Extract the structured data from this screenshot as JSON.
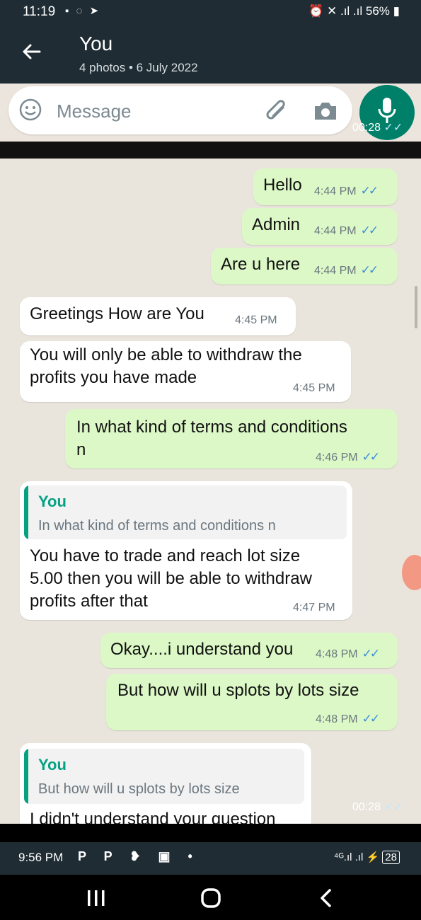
{
  "status_bar": {
    "time": "11:19",
    "battery": "56%"
  },
  "header": {
    "back": "←",
    "contact_name": "You",
    "subtitle": "4 photos • 6 July 2022"
  },
  "compose": {
    "placeholder": "Message"
  },
  "video_overlay": {
    "elapsed": "00:28",
    "ticks": "✓✓"
  },
  "messages": [
    {
      "direction": "out",
      "text": "Hello",
      "time": "4:44 PM",
      "ticks": "✓✓"
    },
    {
      "direction": "out",
      "text": "Admin",
      "time": "4:44 PM",
      "ticks": "✓✓"
    },
    {
      "direction": "out",
      "text": "Are u here",
      "time": "4:44 PM",
      "ticks": "✓✓"
    },
    {
      "direction": "in",
      "text": "Greetings How are You",
      "time": "4:45 PM"
    },
    {
      "direction": "in",
      "line1": "You will only be able to withdraw the",
      "line2": "profits you have made",
      "time": "4:45 PM"
    },
    {
      "direction": "out",
      "line1": "In what kind of terms and  conditions",
      "line2": "n",
      "time": "4:46 PM",
      "ticks": "✓✓"
    },
    {
      "direction": "in",
      "quote_name": "You",
      "quote_text": "In what kind of terms and  conditions n",
      "line1": "You have to trade and reach lot size",
      "line2": "5.00 then you will be able to withdraw",
      "line3": "profits after that",
      "time": "4:47 PM"
    },
    {
      "direction": "out",
      "text": "Okay....i understand you",
      "time": "4:48 PM",
      "ticks": "✓✓"
    },
    {
      "direction": "out",
      "text": "But how will u splots by lots size",
      "time": "4:48 PM",
      "ticks": "✓✓"
    },
    {
      "direction": "in",
      "quote_name": "You",
      "quote_text": "But how will u splots by lots size",
      "text": "I didn't understand your question"
    }
  ],
  "system_bar": {
    "time": "9:56 PM",
    "apps": "P P",
    "battery": "28"
  },
  "navigation": {
    "recents": "|||",
    "home": "○",
    "back": "‹"
  }
}
